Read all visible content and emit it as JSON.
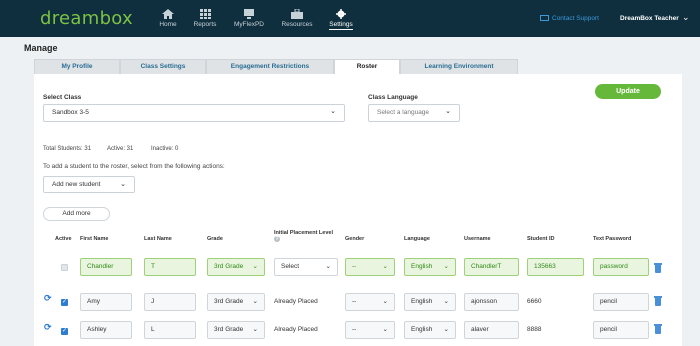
{
  "header": {
    "logo": "dreambox",
    "nav": [
      {
        "label": "Home",
        "icon": "home-icon"
      },
      {
        "label": "Reports",
        "icon": "grid-icon"
      },
      {
        "label": "MyFlexPD",
        "icon": "monitor-icon"
      },
      {
        "label": "Resources",
        "icon": "briefcase-icon"
      },
      {
        "label": "Settings",
        "icon": "gear-icon"
      }
    ],
    "contact_support": "Contact Support",
    "user": "DreamBox Teacher"
  },
  "page_title": "Manage",
  "tabs": [
    {
      "label": "My Profile"
    },
    {
      "label": "Class Settings"
    },
    {
      "label": "Engagement Restrictions"
    },
    {
      "label": "Roster"
    },
    {
      "label": "Learning Environment"
    }
  ],
  "form": {
    "select_class_label": "Select Class",
    "select_class_value": "Sandbox 3-5",
    "class_language_label": "Class Language",
    "class_language_placeholder": "Select a language",
    "update_button": "Update"
  },
  "stats": {
    "total": "Total Students: 31",
    "active": "Active: 31",
    "inactive": "Inactive: 0"
  },
  "instructions": "To add a student to the roster, select from the following actions:",
  "action_select": "Add new student",
  "add_more": "Add more",
  "columns": [
    "Active",
    "First Name",
    "Last Name",
    "Grade",
    "Initial Placement Level",
    "Gender",
    "Language",
    "Username",
    "Student ID",
    "Text Password"
  ],
  "new_row": {
    "first": "Chandler",
    "last": "T",
    "grade": "3rd Grade",
    "placement": "Select",
    "gender": "--",
    "language": "English",
    "username": "ChandlerT",
    "student_id": "135663",
    "password": "password"
  },
  "rows": [
    {
      "first": "Amy",
      "last": "J",
      "grade": "3rd Grade",
      "placement": "Already Placed",
      "gender": "--",
      "language": "English",
      "username": "ajonsson",
      "student_id": "6660",
      "password": "pencil"
    },
    {
      "first": "Ashley",
      "last": "L",
      "grade": "3rd Grade",
      "placement": "Already Placed",
      "gender": "--",
      "language": "English",
      "username": "alaver",
      "student_id": "8888",
      "password": "pencil"
    }
  ],
  "colors": {
    "nav_bg": "#0f2e3e",
    "brand_green": "#7dc242",
    "accent_blue": "#2e7dd1",
    "update_green": "#66b83b"
  }
}
